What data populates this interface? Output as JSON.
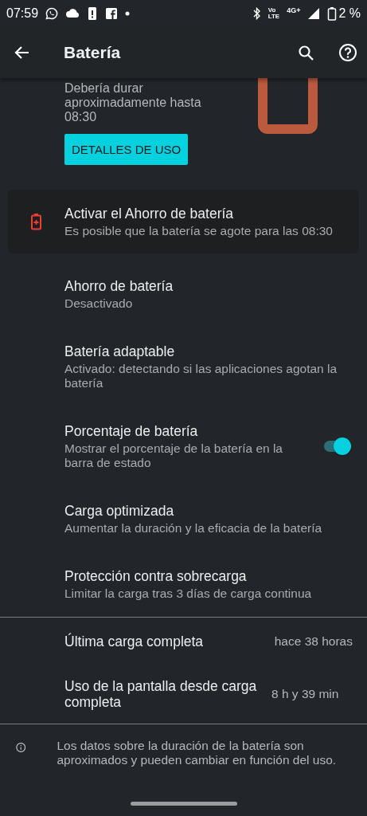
{
  "status_bar": {
    "time": "07:59",
    "volte_top": "Vo",
    "volte_bottom": "LTE",
    "network": "4G+",
    "battery_percent": "2 %"
  },
  "toolbar": {
    "title": "Batería"
  },
  "hero": {
    "estimate": "Debería durar aproximadamente hasta 08:30",
    "button": "DETALLES DE USO"
  },
  "items": [
    {
      "kind": "card",
      "title": "Activar el Ahorro de batería",
      "summary": "Es posible que la batería se agote para las 08:30"
    },
    {
      "kind": "setting",
      "title": "Ahorro de batería",
      "summary": "Desactivado"
    },
    {
      "kind": "setting",
      "title": "Batería adaptable",
      "summary": "Activado: detectando si las aplicaciones agotan la batería"
    },
    {
      "kind": "toggle",
      "title": "Porcentaje de batería",
      "summary": "Mostrar el porcentaje de la batería en la barra de estado",
      "on": true
    },
    {
      "kind": "setting",
      "title": "Carga optimizada",
      "summary": "Aumentar la duración y la eficacia de la batería"
    },
    {
      "kind": "setting",
      "title": "Protección contra sobrecarga",
      "summary": "Limitar la carga tras 3 días de carga continua"
    }
  ],
  "stats": [
    {
      "label": "Última carga completa",
      "value": "hace 38 horas"
    },
    {
      "label": "Uso de la pantalla desde carga completa",
      "value": "8 h y 39 min"
    }
  ],
  "footer": {
    "note": "Los datos sobre la duración de la batería son aproximados y pueden cambiar en función del uso."
  }
}
